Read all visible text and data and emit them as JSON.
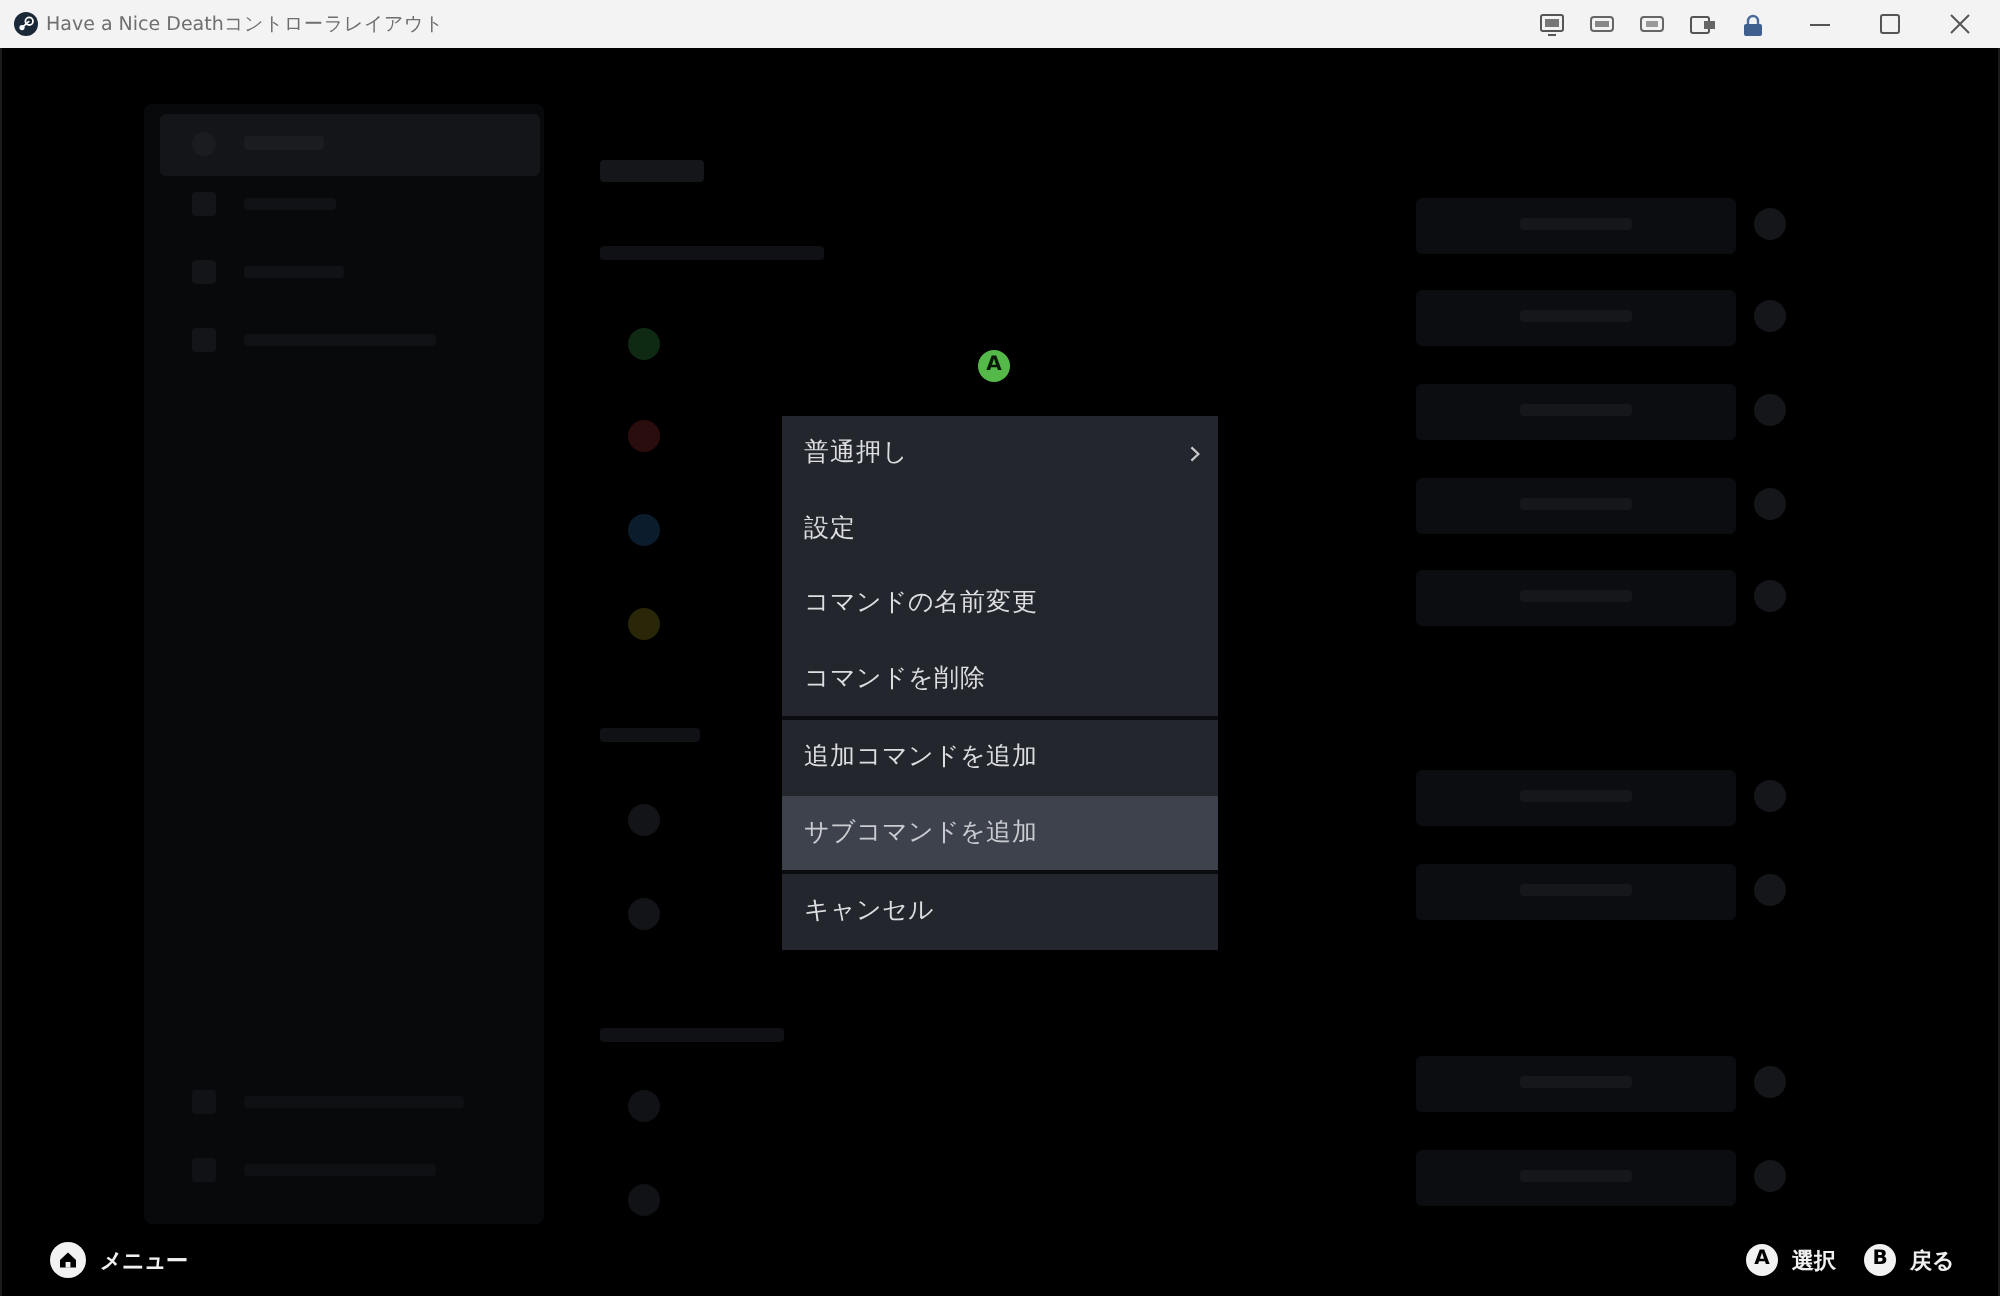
{
  "window": {
    "title": "Have a Nice Deathコントローラレイアウト"
  },
  "prompt_badge": {
    "key": "A"
  },
  "context_menu": {
    "groups": [
      {
        "items": [
          {
            "label": "普通押し",
            "submenu": true,
            "selected": false
          },
          {
            "label": "設定",
            "submenu": false,
            "selected": false
          },
          {
            "label": "コマンドの名前変更",
            "submenu": false,
            "selected": false
          },
          {
            "label": "コマンドを削除",
            "submenu": false,
            "selected": false
          }
        ]
      },
      {
        "items": [
          {
            "label": "追加コマンドを追加",
            "submenu": false,
            "selected": false
          },
          {
            "label": "サブコマンドを追加",
            "submenu": false,
            "selected": true
          }
        ]
      },
      {
        "items": [
          {
            "label": "キャンセル",
            "submenu": false,
            "selected": false
          }
        ]
      }
    ]
  },
  "footer": {
    "menu_hint": {
      "label": "メニュー"
    },
    "hints": [
      {
        "key": "A",
        "label": "選択"
      },
      {
        "key": "B",
        "label": "戻る"
      }
    ]
  }
}
